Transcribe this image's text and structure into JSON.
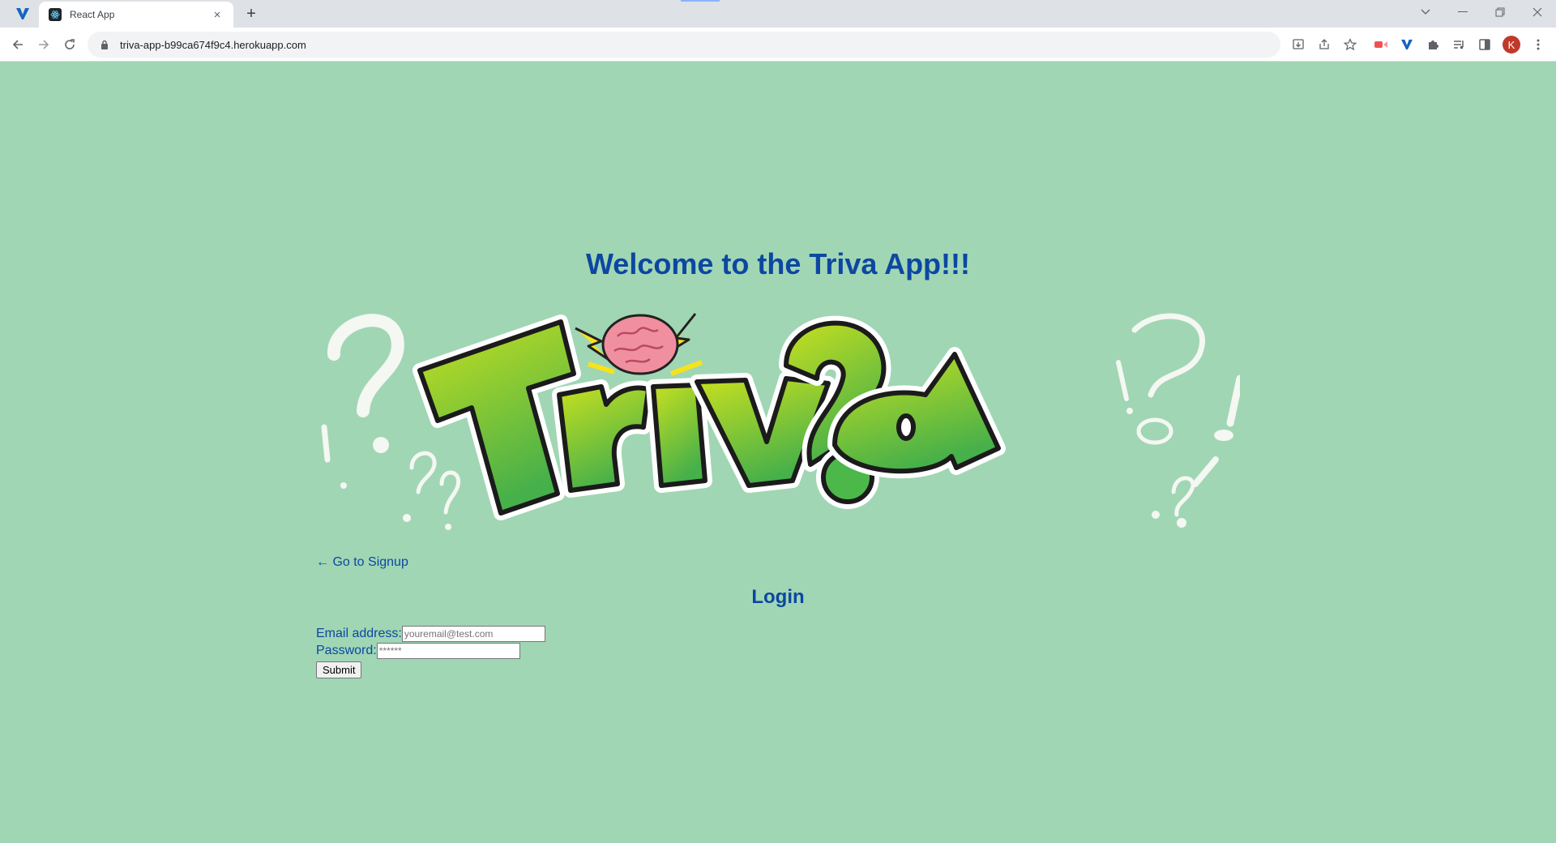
{
  "browser": {
    "tab_title": "React App",
    "tab_close": "×",
    "new_tab": "+",
    "url": "triva-app-b99ca674f9c4.herokuapp.com",
    "profile_initial": "K",
    "icons": [
      "back-arrow-icon",
      "forward-arrow-icon",
      "reload-icon",
      "lock-icon",
      "install-app-icon",
      "share-icon",
      "bookmark-star-icon",
      "extension-icon",
      "extensions-puzzle-icon",
      "reading-list-icon",
      "side-panel-icon",
      "menu-kebab-icon"
    ]
  },
  "page": {
    "welcome_heading": "Welcome to the Triva App!!!",
    "logo_text": "Triv?a",
    "signup_link": "← Go to Signup",
    "login_heading": "Login",
    "email_label": "Email address:",
    "email_placeholder": "youremail@test.com",
    "password_label": "Password:",
    "password_placeholder": "******",
    "submit_label": "Submit"
  },
  "colors": {
    "background": "#a0d6b4",
    "heading": "#0d47a1",
    "logo_green": "#8cc63f"
  }
}
